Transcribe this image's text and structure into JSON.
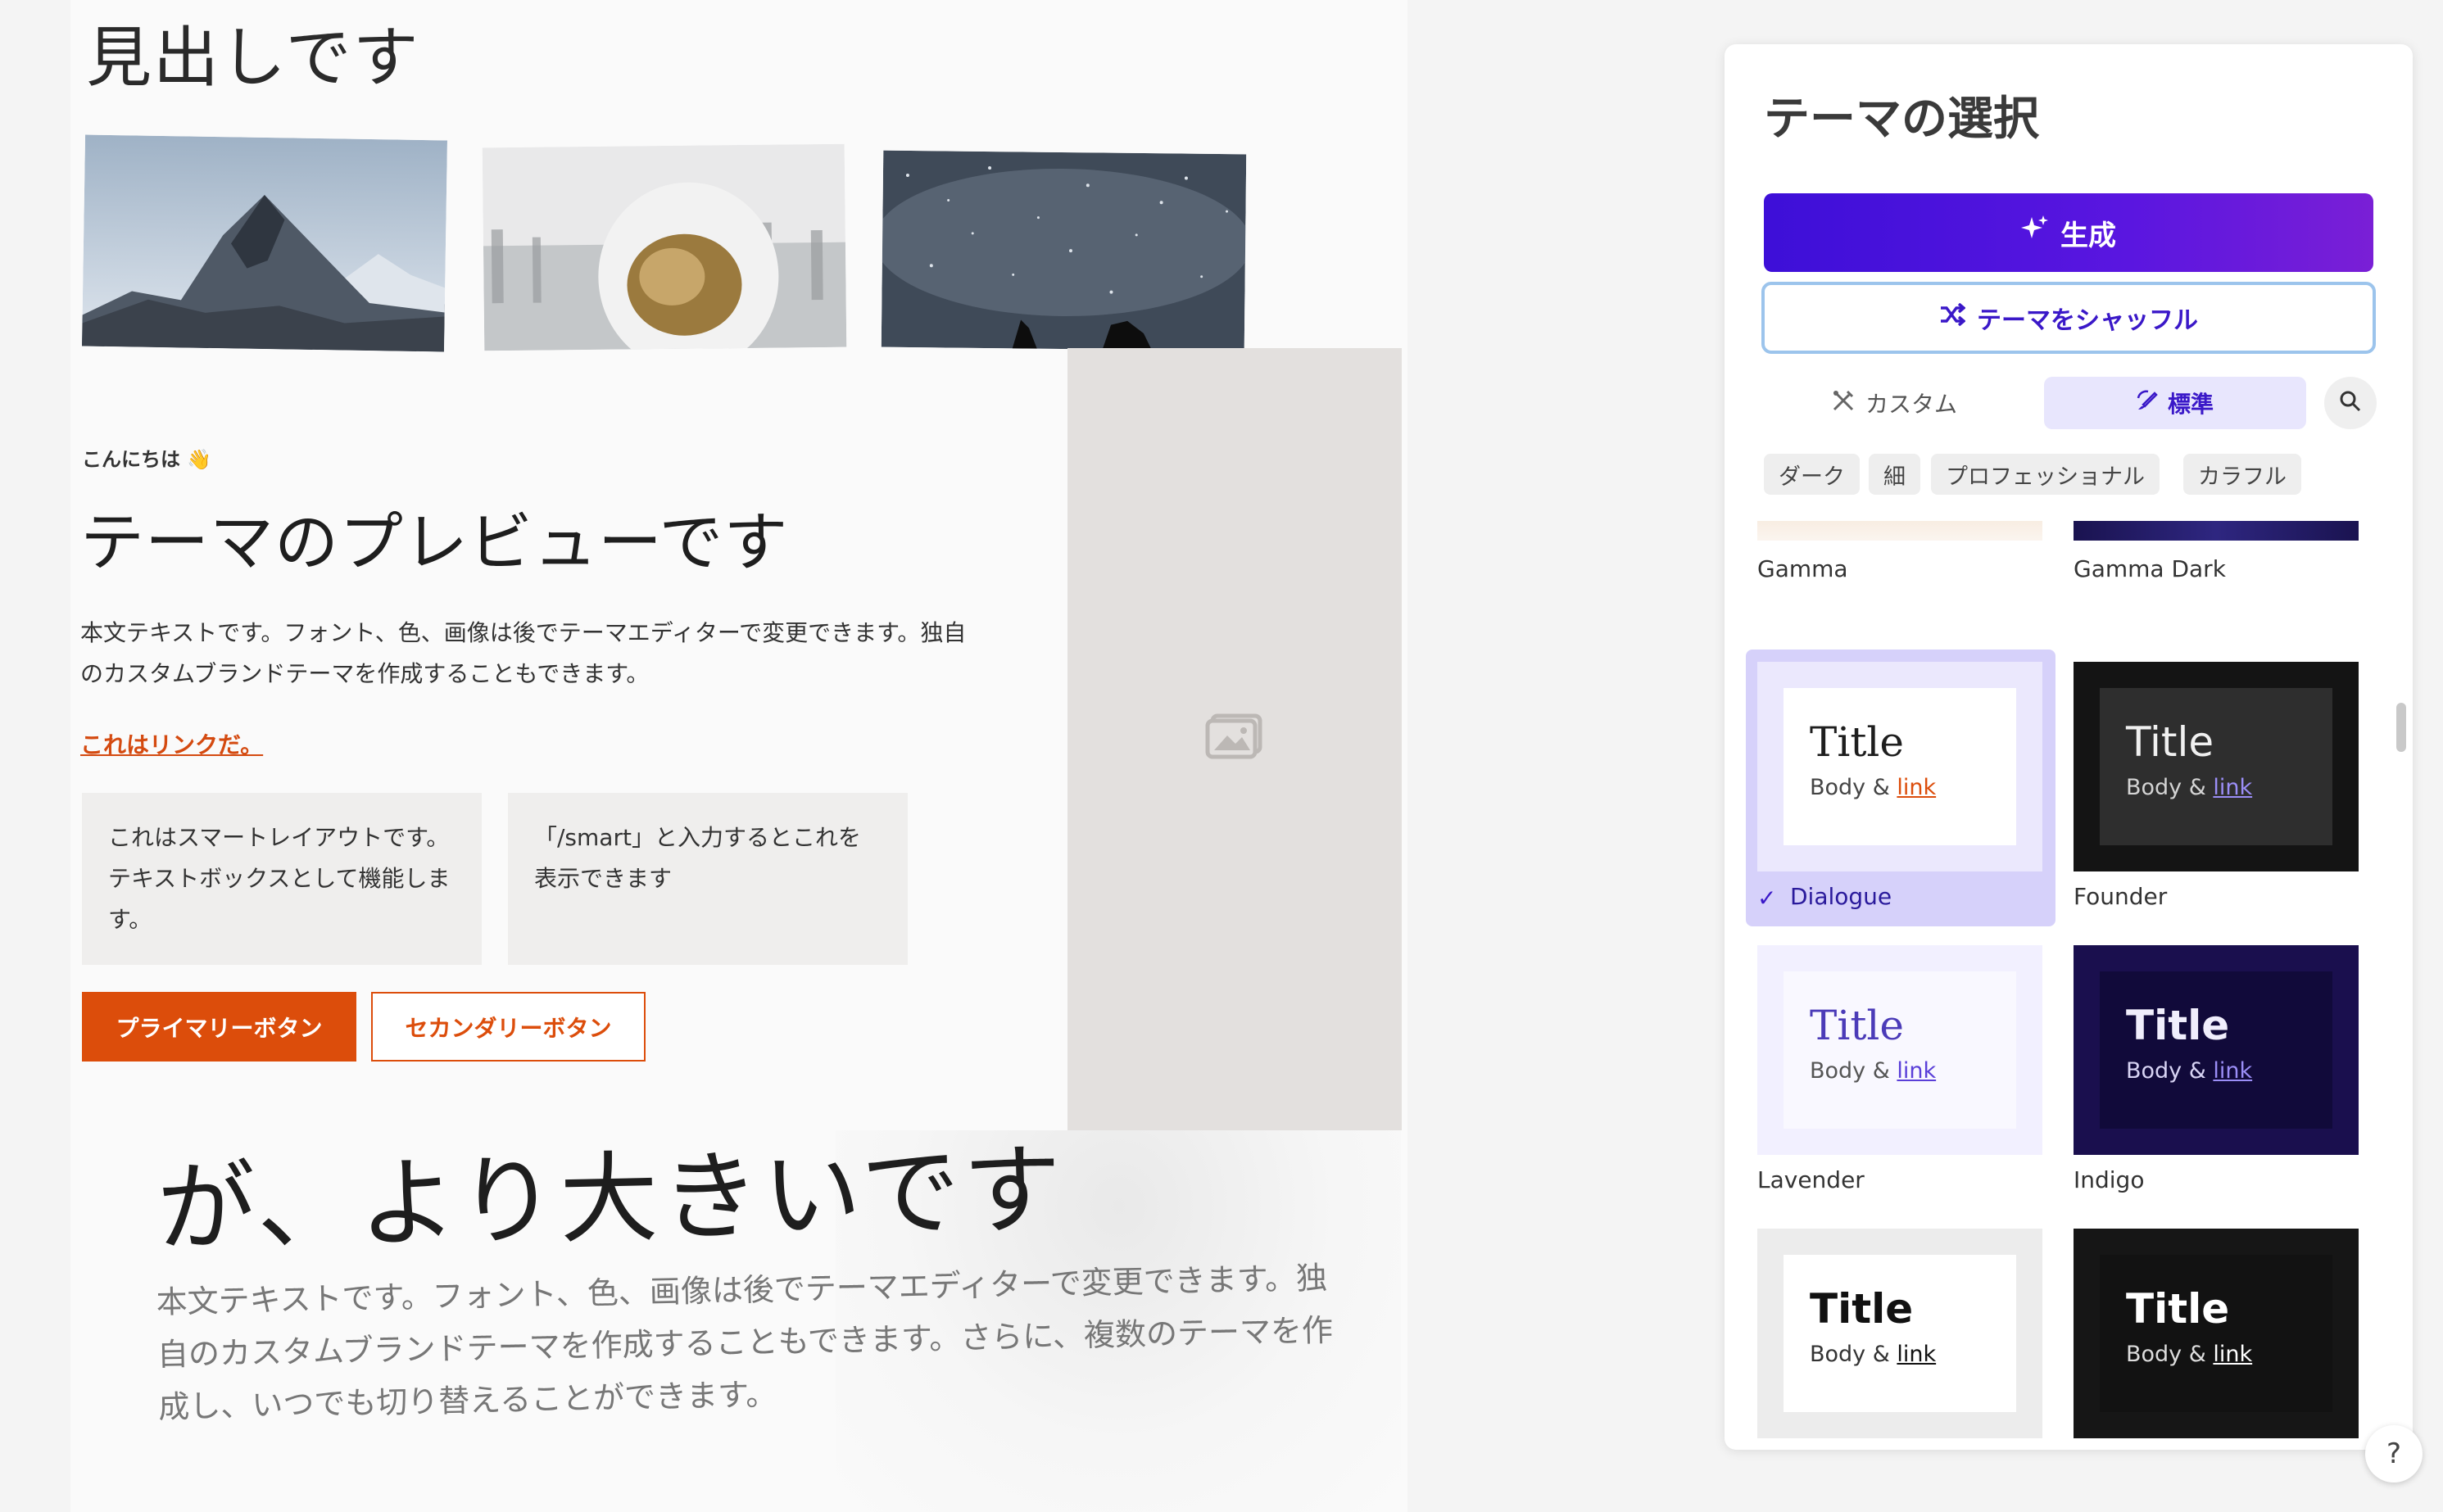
{
  "preview": {
    "heading_top": "見出しです",
    "greeting": "こんにちは 👋",
    "title": "テーマのプレビューです",
    "body": "本文テキストです。フォント、色、画像は後でテーマエディターで変更できます。独自のカスタムブランドテーマを作成することもできます。",
    "link": "これはリンクだ。",
    "smart_box_1": "これはスマートレイアウトです。テキストボックスとして機能します。",
    "smart_box_2": "「/smart」と入力するとこれを表示できます",
    "primary_button": "プライマリーボタン",
    "secondary_button": "セカンダリーボタン",
    "big_heading": "が、より大きいです",
    "big_body": "本文テキストです。フォント、色、画像は後でテーマエディターで変更できます。独自のカスタムブランドテーマを作成することもできます。さらに、複数のテーマを作成し、いつでも切り替えることができます。",
    "accent_color": "#dc4d0b"
  },
  "panel": {
    "title": "テーマの選択",
    "generate_label": "生成",
    "shuffle_label": "テーマをシャッフル",
    "tab_custom": "カスタム",
    "tab_standard": "標準",
    "chips": [
      "ダーク",
      "細",
      "プロフェッショナル",
      "カラフル"
    ],
    "themes": [
      {
        "name": "Gamma"
      },
      {
        "name": "Gamma Dark"
      },
      {
        "name": "Dialogue",
        "selected": true,
        "title": "Title",
        "body": "Body & ",
        "link": "link"
      },
      {
        "name": "Founder",
        "title": "Title",
        "body": "Body & ",
        "link": "link"
      },
      {
        "name": "Lavender",
        "title": "Title",
        "body": "Body & ",
        "link": "link"
      },
      {
        "name": "Indigo",
        "title": "Title",
        "body": "Body & ",
        "link": "link"
      },
      {
        "name": "",
        "title": "Title",
        "body": "Body & ",
        "link": "link"
      },
      {
        "name": "",
        "title": "Title",
        "body": "Body & ",
        "link": "link"
      }
    ],
    "help": "?"
  }
}
